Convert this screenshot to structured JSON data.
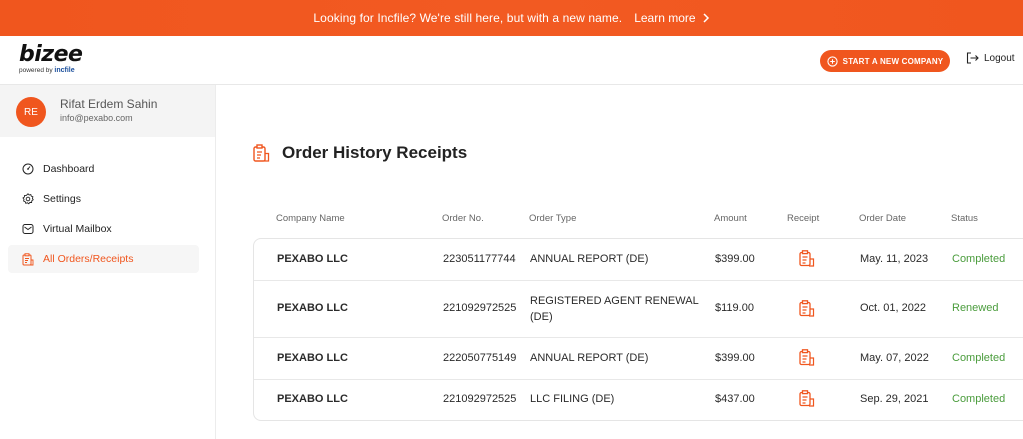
{
  "banner": {
    "message": "Looking for Incfile? We're still here, but with a new name.",
    "link_label": "Learn more"
  },
  "header": {
    "logo_text": "bizee",
    "powered_by": "powered by",
    "powered_brand": "incfile",
    "start_button": "START A NEW COMPANY",
    "logout_label": "Logout"
  },
  "user": {
    "initials": "RE",
    "name": "Rifat Erdem Sahin",
    "email": "info@pexabo.com"
  },
  "sidebar": {
    "items": [
      {
        "label": "Dashboard",
        "icon": "dashboard-icon"
      },
      {
        "label": "Settings",
        "icon": "gear-icon"
      },
      {
        "label": "Virtual Mailbox",
        "icon": "mailbox-icon"
      },
      {
        "label": "All Orders/Receipts",
        "icon": "receipt-icon"
      }
    ]
  },
  "page": {
    "title": "Order History Receipts"
  },
  "table": {
    "columns": [
      "Company Name",
      "Order No.",
      "Order Type",
      "Amount",
      "Receipt",
      "Order Date",
      "Status"
    ],
    "rows": [
      {
        "company": "PEXABO LLC",
        "order_no": "223051177744",
        "order_type": "ANNUAL REPORT (DE)",
        "amount": "$399.00",
        "date": "May. 11, 2023",
        "status": "Completed"
      },
      {
        "company": "PEXABO LLC",
        "order_no": "221092972525",
        "order_type": "REGISTERED AGENT RENEWAL (DE)",
        "amount": "$119.00",
        "date": "Oct. 01, 2022",
        "status": "Renewed"
      },
      {
        "company": "PEXABO LLC",
        "order_no": "222050775149",
        "order_type": "ANNUAL REPORT (DE)",
        "amount": "$399.00",
        "date": "May. 07, 2022",
        "status": "Completed"
      },
      {
        "company": "PEXABO LLC",
        "order_no": "221092972525",
        "order_type": "LLC FILING (DE)",
        "amount": "$437.00",
        "date": "Sep. 29, 2021",
        "status": "Completed"
      }
    ]
  },
  "colors": {
    "accent": "#f0561e",
    "status_green": "#4a9c3c"
  }
}
